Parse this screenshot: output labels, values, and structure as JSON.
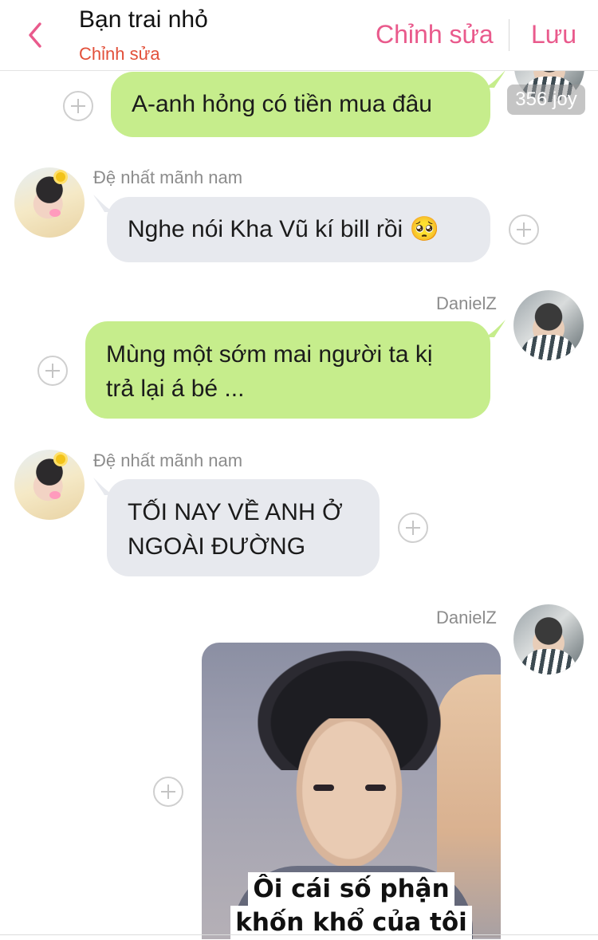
{
  "header": {
    "title": "Bạn trai nhỏ",
    "subtitle": "Chỉnh sửa",
    "edit_label": "Chỉnh sửa",
    "save_label": "Lưu",
    "accent_color": "#e95a8c"
  },
  "badge": {
    "text": "356 joy"
  },
  "messages": [
    {
      "from": "DanielZ",
      "side": "right",
      "text": "A-anh hỏng có tiền mua đâu"
    },
    {
      "from": "Đệ nhất mãnh nam",
      "side": "left",
      "text": "Nghe nói Kha Vũ kí bill rồi 🥺"
    },
    {
      "from": "DanielZ",
      "side": "right",
      "line1": "Mùng một sớm mai người ta kị",
      "line2": "trả lại á bé ..."
    },
    {
      "from": "Đệ nhất mãnh nam",
      "side": "left",
      "line1": "TỐI NAY VỀ ANH Ở",
      "line2": "NGOÀI ĐƯỜNG"
    },
    {
      "from": "DanielZ",
      "side": "right",
      "type": "image",
      "caption1": "Ôi cái số phận",
      "caption2": "khốn khổ của tôi"
    }
  ],
  "colors": {
    "bubble_mine": "#c6ed8c",
    "bubble_theirs": "#e7e9ee",
    "subtitle": "#e2503a"
  },
  "icons": [
    "back-chevron-icon",
    "add-circle-icon",
    "avatar-danielz",
    "avatar-de-nhat-manh-nam"
  ]
}
